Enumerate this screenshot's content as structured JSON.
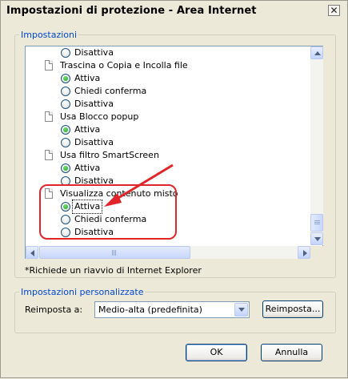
{
  "dialog": {
    "title": "Impostazioni di protezione - Area Internet",
    "close_glyph": "✕"
  },
  "settings_group": {
    "legend": "Impostazioni",
    "items": [
      {
        "kind": "option",
        "label": "Disattiva",
        "checked": false
      },
      {
        "kind": "header",
        "label": "Trascina o Copia e Incolla file"
      },
      {
        "kind": "option",
        "label": "Attiva",
        "checked": true
      },
      {
        "kind": "option",
        "label": "Chiedi conferma",
        "checked": false
      },
      {
        "kind": "option",
        "label": "Disattiva",
        "checked": false
      },
      {
        "kind": "header",
        "label": "Usa Blocco popup"
      },
      {
        "kind": "option",
        "label": "Attiva",
        "checked": true
      },
      {
        "kind": "option",
        "label": "Disattiva",
        "checked": false
      },
      {
        "kind": "header",
        "label": "Usa filtro SmartScreen"
      },
      {
        "kind": "option",
        "label": "Attiva",
        "checked": true
      },
      {
        "kind": "option",
        "label": "Disattiva",
        "checked": false
      },
      {
        "kind": "header",
        "label": "Visualizza contenuto misto"
      },
      {
        "kind": "option",
        "label": "Attiva",
        "checked": true,
        "focused": true
      },
      {
        "kind": "option",
        "label": "Chiedi conferma",
        "checked": false
      },
      {
        "kind": "option",
        "label": "Disattiva",
        "checked": false
      }
    ],
    "restart_note": "*Richiede un riavvio di Internet Explorer"
  },
  "custom_group": {
    "legend": "Impostazioni personalizzate",
    "reset_label": "Reimposta a:",
    "reset_value": "Medio-alta (predefinita)",
    "reset_button": "Reimposta..."
  },
  "footer": {
    "ok_label": "OK",
    "cancel_label": "Annulla"
  },
  "annotation": {
    "color": "#e1262b"
  }
}
